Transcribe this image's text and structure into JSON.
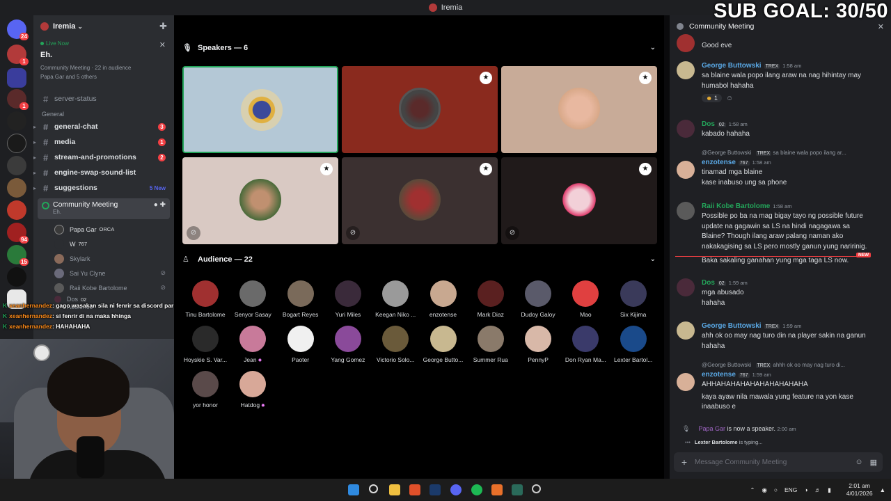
{
  "window": {
    "title": "Iremia"
  },
  "stream_overlay": {
    "sub_goal": "SUB GOAL: 30/50",
    "chat": [
      {
        "user": "xeanhernandez",
        "text": "gago wasakan sila ni fenrir sa discord par"
      },
      {
        "user": "xeanhernandez",
        "text": "si fenrir di na maka hhinga"
      },
      {
        "user": "xeanhernandez",
        "text": "HAHAHAHA"
      }
    ]
  },
  "rail": {
    "badges": [
      "24",
      "1",
      "1",
      "94",
      "15"
    ]
  },
  "sidebar": {
    "server_name": "Iremia",
    "live": {
      "label": "Live Now",
      "title": "Eh.",
      "meta": "Community Meeting · 22 in audience",
      "friends": "Papa Gar and 5 others"
    },
    "server_status": "server-status",
    "category": "General",
    "channels": [
      {
        "name": "general-chat",
        "badge": "3"
      },
      {
        "name": "media",
        "badge": "1"
      },
      {
        "name": "stream-and-promotions",
        "badge": "2"
      },
      {
        "name": "engine-swap-sound-list",
        "badge": ""
      },
      {
        "name": "suggestions",
        "badge": "5 New"
      }
    ],
    "stage_channel": {
      "name": "Community Meeting",
      "topic": "Eh."
    },
    "members": [
      {
        "name": "Papa Gar",
        "tag": "ORCA"
      },
      {
        "name": "W",
        "tag": "767"
      },
      {
        "name": "Skylark",
        "tag": ""
      },
      {
        "name": "Sai Yu Clyne",
        "tag": ""
      },
      {
        "name": "Raii Kobe Bartolome",
        "tag": ""
      },
      {
        "name": "Dos",
        "tag": "02"
      },
      {
        "name": "Audience",
        "tag": ""
      }
    ]
  },
  "stage": {
    "speakers_header": "Speakers — 6",
    "audience_header": "Audience — 22",
    "audience": [
      "Tinu Bartolome",
      "Senyor Sasay",
      "Bogart Reyes",
      "Yuri Miles",
      "Keegan Niko ...",
      "enzotense",
      "Mark Diaz",
      "Dudoy Galoy",
      "Mao",
      "Six Kijima",
      "Hoyskie S. Var...",
      "Jean",
      "Paoter",
      "Yang Gomez",
      "Victorio Solo...",
      "George Butto...",
      "Summer Rua",
      "PennyP",
      "Don Ryan Ma...",
      "Lexter Bartol...",
      "yor honor",
      "Hatdog"
    ]
  },
  "chat": {
    "title": "Community Meeting",
    "messages": [
      {
        "text": "Good eve"
      },
      {
        "name": "George Buttowski",
        "tag": "TREX",
        "time": "1:58 am",
        "lines": [
          "sa blaine wala popo ilang araw na nag hihintay may",
          "humabol hahaha"
        ],
        "reaction_count": "1"
      },
      {
        "name": "Dos",
        "tag": "02",
        "time": "1:58 am",
        "lines": [
          "kabado hahaha"
        ]
      },
      {
        "reply": "@George Buttowski",
        "reply_tag": "TREX",
        "reply_text": "sa blaine wala popo ilang ar...",
        "name": "enzotense",
        "tag": "767",
        "time": "1:58 am",
        "lines": [
          "tinamad mga blaine",
          "kase inabuso ung sa phone"
        ]
      },
      {
        "name": "Raii Kobe Bartolome",
        "time": "1:58 am",
        "lines": [
          "Possible po ba na mag bigay tayo ng possible future",
          "update na gagawin sa LS na hindi nagagawa sa",
          "Blaine? Though ilang araw palang naman ako",
          "nakakagising sa LS pero mostly ganun yung naririnig.",
          "Baka sakaling ganahan yung mga taga LS now."
        ]
      },
      {
        "name": "Dos",
        "tag": "02",
        "time": "1:59 am",
        "lines": [
          "mga abusado",
          "hahaha"
        ]
      },
      {
        "name": "George Buttowski",
        "tag": "TREX",
        "time": "1:59 am",
        "lines": [
          "ahh ok oo may nag turo din na player sakin na ganun",
          "hahaha"
        ]
      },
      {
        "reply": "@George Buttowski",
        "reply_tag": "TREX",
        "reply_text": "ahhh ok oo may nag turo di...",
        "name": "enzotense",
        "tag": "767",
        "time": "1:59 am",
        "lines": [
          "AHHAHAHAHAHAHAHAHAHAHA",
          "kaya ayaw nila mawala yung feature na yon kase",
          "inaabuso e"
        ]
      }
    ],
    "new_label": "NEW",
    "system": {
      "name": "Papa Gar",
      "text": "is now a speaker.",
      "time": "2:00 am"
    },
    "typing": {
      "name": "Lexter Bartolome",
      "text": "is typing..."
    },
    "composer_placeholder": "Message Community Meeting"
  },
  "taskbar": {
    "lang": "ENG",
    "time": "2:01 am",
    "date": "4/01/2026"
  }
}
